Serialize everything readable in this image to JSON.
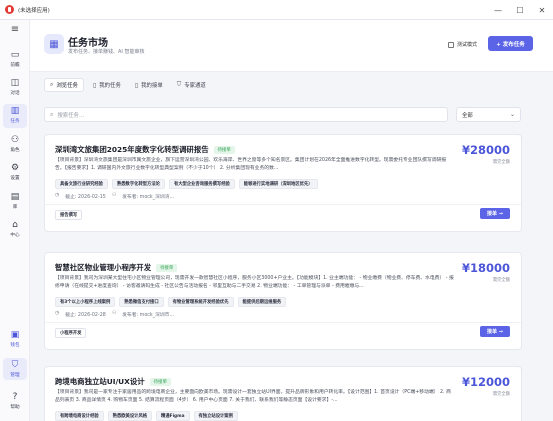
{
  "window": {
    "title": "(未选择应用)",
    "controls": [
      "—",
      "☐",
      "✕"
    ]
  },
  "sidebar": {
    "menu_icon": "≡",
    "items": [
      {
        "label": "前瞻",
        "icon": "inbox-icon",
        "glyph": "▭"
      },
      {
        "label": "对话",
        "icon": "chat-icon",
        "glyph": "◫"
      },
      {
        "label": "任务",
        "icon": "task-icon",
        "glyph": "▥"
      },
      {
        "label": "角色",
        "icon": "users-icon",
        "glyph": "⚇"
      },
      {
        "label": "设置",
        "icon": "gear-icon",
        "glyph": "⚙"
      },
      {
        "label": "库",
        "icon": "library-icon",
        "glyph": "▤"
      },
      {
        "label": "中心",
        "icon": "store-icon",
        "glyph": "⌂"
      }
    ],
    "bottom_items": [
      {
        "label": "钱包",
        "icon": "wallet-icon",
        "glyph": "▣"
      },
      {
        "label": "管理",
        "icon": "shield-icon",
        "glyph": "⛉"
      },
      {
        "label": "帮助",
        "icon": "help-icon",
        "glyph": "?"
      }
    ]
  },
  "header": {
    "title": "任务市场",
    "subtitle": "发布任务、接单赚钱、AI 智能审核",
    "test_mode_label": "测试模式",
    "publish_label": "+ 发布任务"
  },
  "tabs": [
    {
      "label": "浏览任务",
      "icon": "search-icon",
      "glyph": "⌕"
    },
    {
      "label": "我的任务",
      "icon": "document-icon",
      "glyph": "▯"
    },
    {
      "label": "我的接单",
      "icon": "document-icon",
      "glyph": "▯"
    },
    {
      "label": "专家通道",
      "icon": "shield-icon",
      "glyph": "⛉"
    }
  ],
  "search": {
    "placeholder": "搜索任务..."
  },
  "filter": {
    "selected": "全部"
  },
  "tasks": [
    {
      "title": "深圳湾文旅集团2025年度数字化转型调研报告",
      "status": "待接单",
      "price": "¥28000",
      "price_note": "需完全额",
      "desc": "【项目背景】深圳湾文旅集团是深圳市属文旅企业，旗下运营深圳湾公园、欢乐海岸、世界之窗等多个知名景区。集团计划在2026年全面推进数字化转型。现需委托专业团队撰写调研报告。【报告要求】1. 调研国内外文旅行业数字化转型典型案例（不少于10个）  2. 分析集团现有业务的数...",
      "tags": [
        "具备文旅行业研究经验",
        "熟悉数字化转型方法论",
        "有大型企业咨询服务撰写经验",
        "能够进行实地调研（深圳地区优先）"
      ],
      "deadline": "截止: 2026-02-15",
      "publisher": "发布者: mock_深圳湾...",
      "skill": "报告撰写",
      "action": "接单 →"
    },
    {
      "title": "智慧社区物业管理小程序开发",
      "status": "待接单",
      "price": "¥18000",
      "price_note": "需完全额",
      "desc": "【项目背景】我司为深圳某大型住宅小区物业管理公司，现需开发一款智慧社区小程序，服务小区3000+户业主。【功能模块】1. 业主端功能： - 物业缴费（物业费、停车费、水电费） - 报修申请（在线提交+进度查询） - 访客邀请码生成 - 社区公告与活动报名 - 邻里互助与二手交易 2. 物业端功能： - 工单管理与派单 - 费用催缴与...",
      "tags": [
        "有3个以上小程序上线案例",
        "熟悉微信支付接口",
        "有物业管理系统开发经验优先",
        "能提供后期运维服务"
      ],
      "deadline": "截止: 2026-02-28",
      "publisher": "发布者: mock_深圳市...",
      "skill": "小程序开发",
      "action": "接单 →"
    },
    {
      "title": "跨境电商独立站UI/UX设计",
      "status": "待接单",
      "price": "¥12000",
      "price_note": "需完全额",
      "desc": "【项目背景】我司是一家专注于家居用品的跨境电商企业，主要面向欧美市场。现需设计一套独立站UI界面，提升品牌形象和用户转化率。【设计范围】1. 首页设计（PC端+移动端） 2. 商品列表页 3. 商品详情页 4. 购物车页面 5. 结算流程页面（4步） 6. 用户中心页面 7. 关于我们、联系我们等静态页面【设计要求】-...",
      "tags": [
        "有跨境电商设计经验",
        "熟悉欧美设计风格",
        "精通Figma",
        "有独立站设计案例"
      ],
      "deadline": "",
      "publisher": "",
      "skill": "",
      "action": ""
    }
  ]
}
